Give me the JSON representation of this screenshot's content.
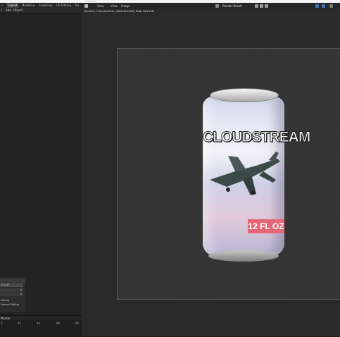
{
  "workspace_tabs": [
    "Layout",
    "Modeling",
    "Sculpting",
    "UV Editing",
    "Tex"
  ],
  "active_tab": "Layout",
  "left_header_menu": [
    "Add",
    "Object"
  ],
  "operator_panel": {
    "value": "-0.118\"",
    "rows": [
      "Editing",
      "Normal Editing"
    ]
  },
  "timeline": {
    "header_label": "Marker",
    "ruler": [
      "0",
      "20",
      "40",
      "60",
      "80"
    ]
  },
  "image_editor": {
    "menus": [
      "View",
      "View",
      "Image"
    ],
    "slot_label": "Render Result",
    "frame_info": "Frame:0 | Time:00:43.34 | Mem:624.09M, Peak: 624.09M"
  },
  "can": {
    "brand": "CLOUDSTREAM",
    "volume": "12 FL OZ"
  },
  "colors": {
    "accent": "#4772b3",
    "badge": "#e46677"
  }
}
